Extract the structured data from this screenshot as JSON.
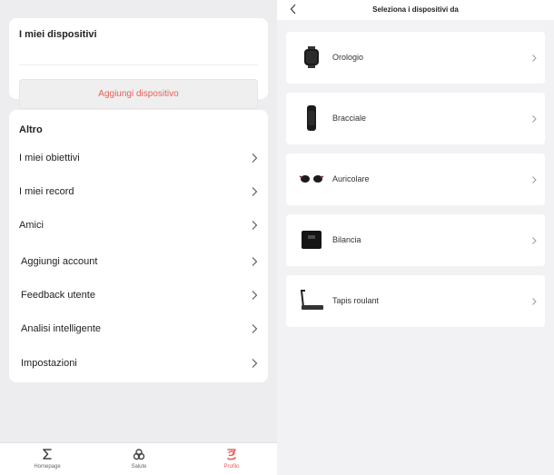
{
  "left": {
    "devices_title": "I miei dispositivi",
    "add_device_label": "Aggiungi dispositivo",
    "other_title": "Altro",
    "menu": [
      {
        "label": "I miei obiettivi"
      },
      {
        "label": "I miei record"
      },
      {
        "label": "Amici"
      },
      {
        "label": "Aggiungi account"
      },
      {
        "label": "Feedback utente"
      },
      {
        "label": "Analisi intelligente"
      },
      {
        "label": "Impostazioni"
      }
    ],
    "nav": [
      {
        "label": "Homepage",
        "icon": "sigma-icon"
      },
      {
        "label": "Salute",
        "icon": "health-icon"
      },
      {
        "label": "Profilo",
        "icon": "profile-icon",
        "active": true
      }
    ]
  },
  "right": {
    "title": "Seleziona i dispositivi da",
    "devices": [
      {
        "label": "Orologio",
        "icon": "watch-icon"
      },
      {
        "label": "Bracciale",
        "icon": "band-icon"
      },
      {
        "label": "Auricolare",
        "icon": "earbuds-icon"
      },
      {
        "label": "Bilancia",
        "icon": "scale-icon"
      },
      {
        "label": "Tapis roulant",
        "icon": "treadmill-icon"
      }
    ]
  },
  "colors": {
    "accent": "#e7605a",
    "left_background": "#ededef",
    "right_background": "#f2f2f4"
  }
}
